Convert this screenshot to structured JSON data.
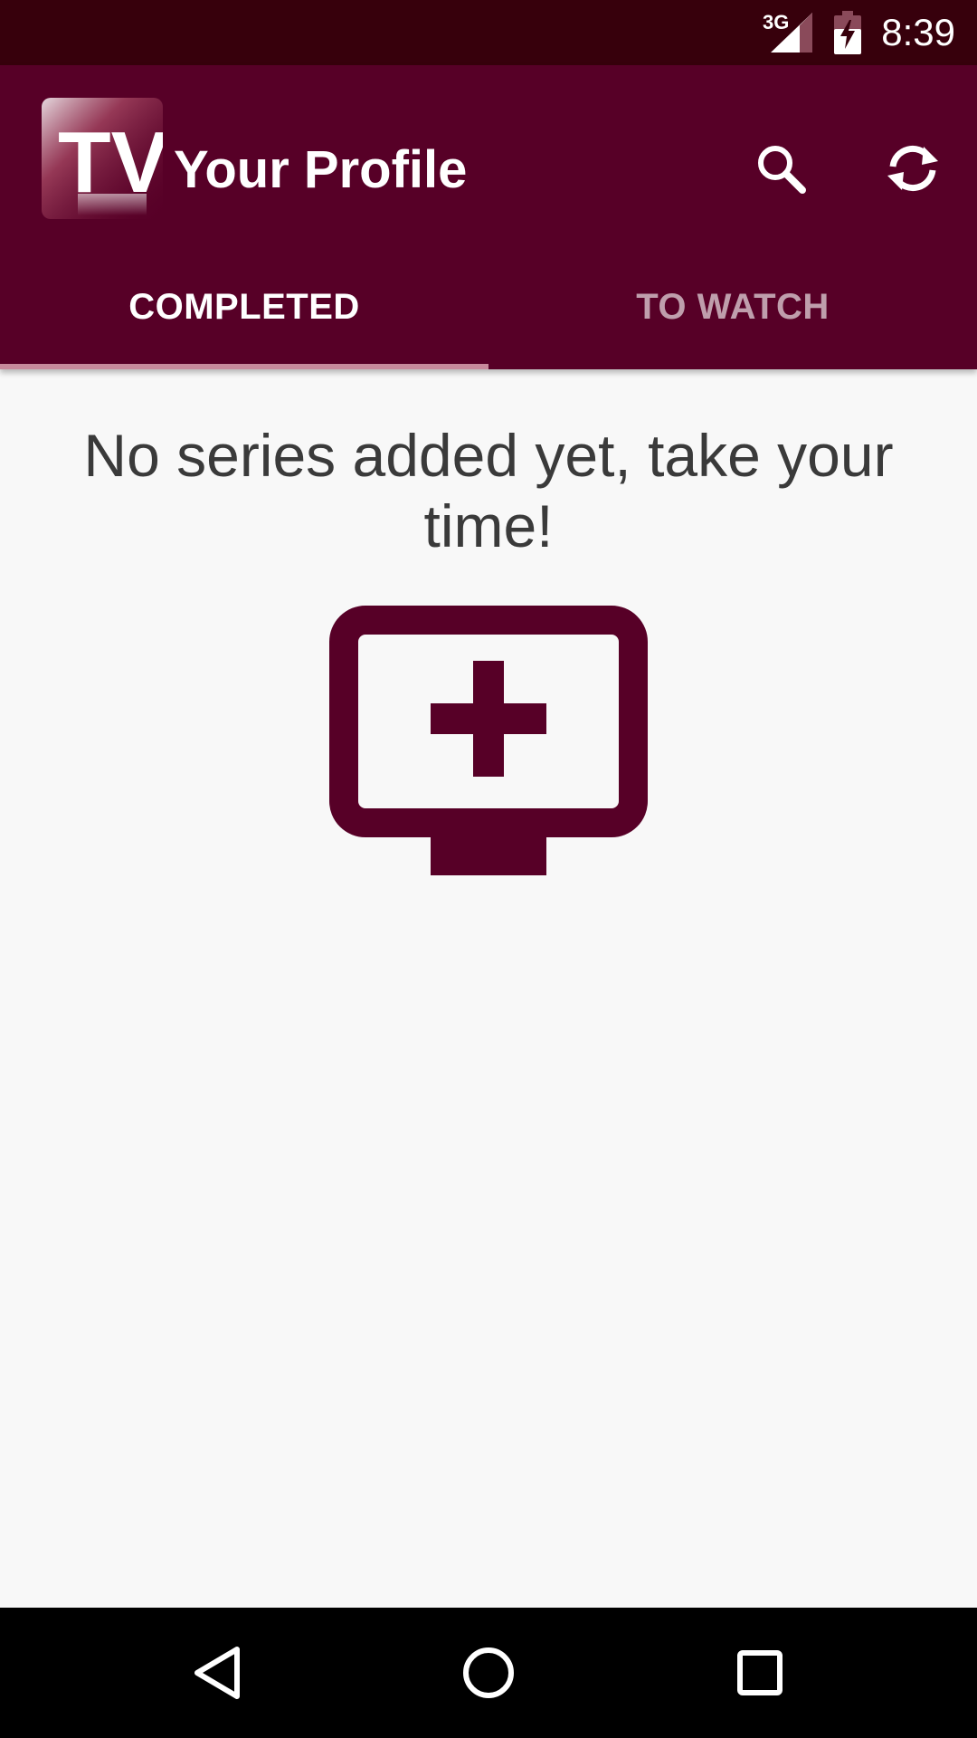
{
  "status_bar": {
    "network": "3G",
    "time": "8:39",
    "icons": [
      "signal-icon",
      "battery-charging-icon"
    ]
  },
  "app_bar": {
    "logo_text": "TV",
    "title": "Your Profile",
    "actions": [
      {
        "name": "search",
        "icon": "search-icon"
      },
      {
        "name": "sync",
        "icon": "sync-icon"
      }
    ]
  },
  "tabs": [
    {
      "label": "COMPLETED",
      "selected": true
    },
    {
      "label": "TO WATCH",
      "selected": false
    }
  ],
  "content": {
    "empty_message": "No series added yet, take your time!",
    "icon": "add-to-queue-icon"
  },
  "nav_bar": {
    "icons": [
      "back-icon",
      "home-icon",
      "recents-icon"
    ]
  },
  "colors": {
    "status_bar": "#37000c",
    "primary": "#570027",
    "tab_indicator": "#c78a9c",
    "background": "#f8f8f8",
    "text": "#3a3a3a"
  }
}
